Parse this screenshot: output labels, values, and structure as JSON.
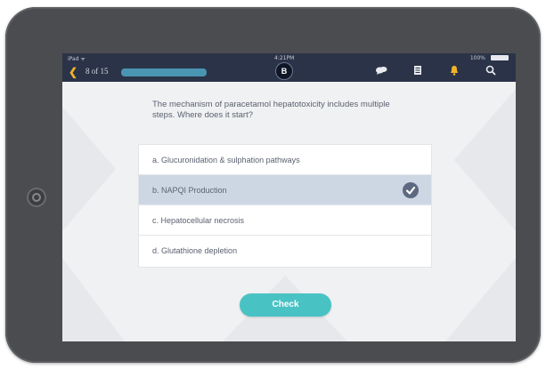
{
  "status": {
    "carrier": "iPad ᯤ",
    "time": "4:21PM",
    "battery": "100%"
  },
  "header": {
    "back_icon": "chevron-left",
    "progress": "8 of 15",
    "badge": "B",
    "tools": [
      "chat-bubbles-icon",
      "notes-icon",
      "bell-icon",
      "search-icon"
    ],
    "accent": "#f0b429"
  },
  "question": {
    "text": "The mechanism of paracetamol hepatotoxicity includes multiple steps. Where does it start?",
    "options": [
      {
        "label": "a. Glucuronidation & sulphation pathways",
        "selected": false
      },
      {
        "label": "b. NAPQI Production",
        "selected": true
      },
      {
        "label": "c. Hepatocellular necrosis",
        "selected": false
      },
      {
        "label": "d. Glutathione depletion",
        "selected": false
      }
    ]
  },
  "actions": {
    "check_label": "Check",
    "check_color": "#49c2c4"
  }
}
